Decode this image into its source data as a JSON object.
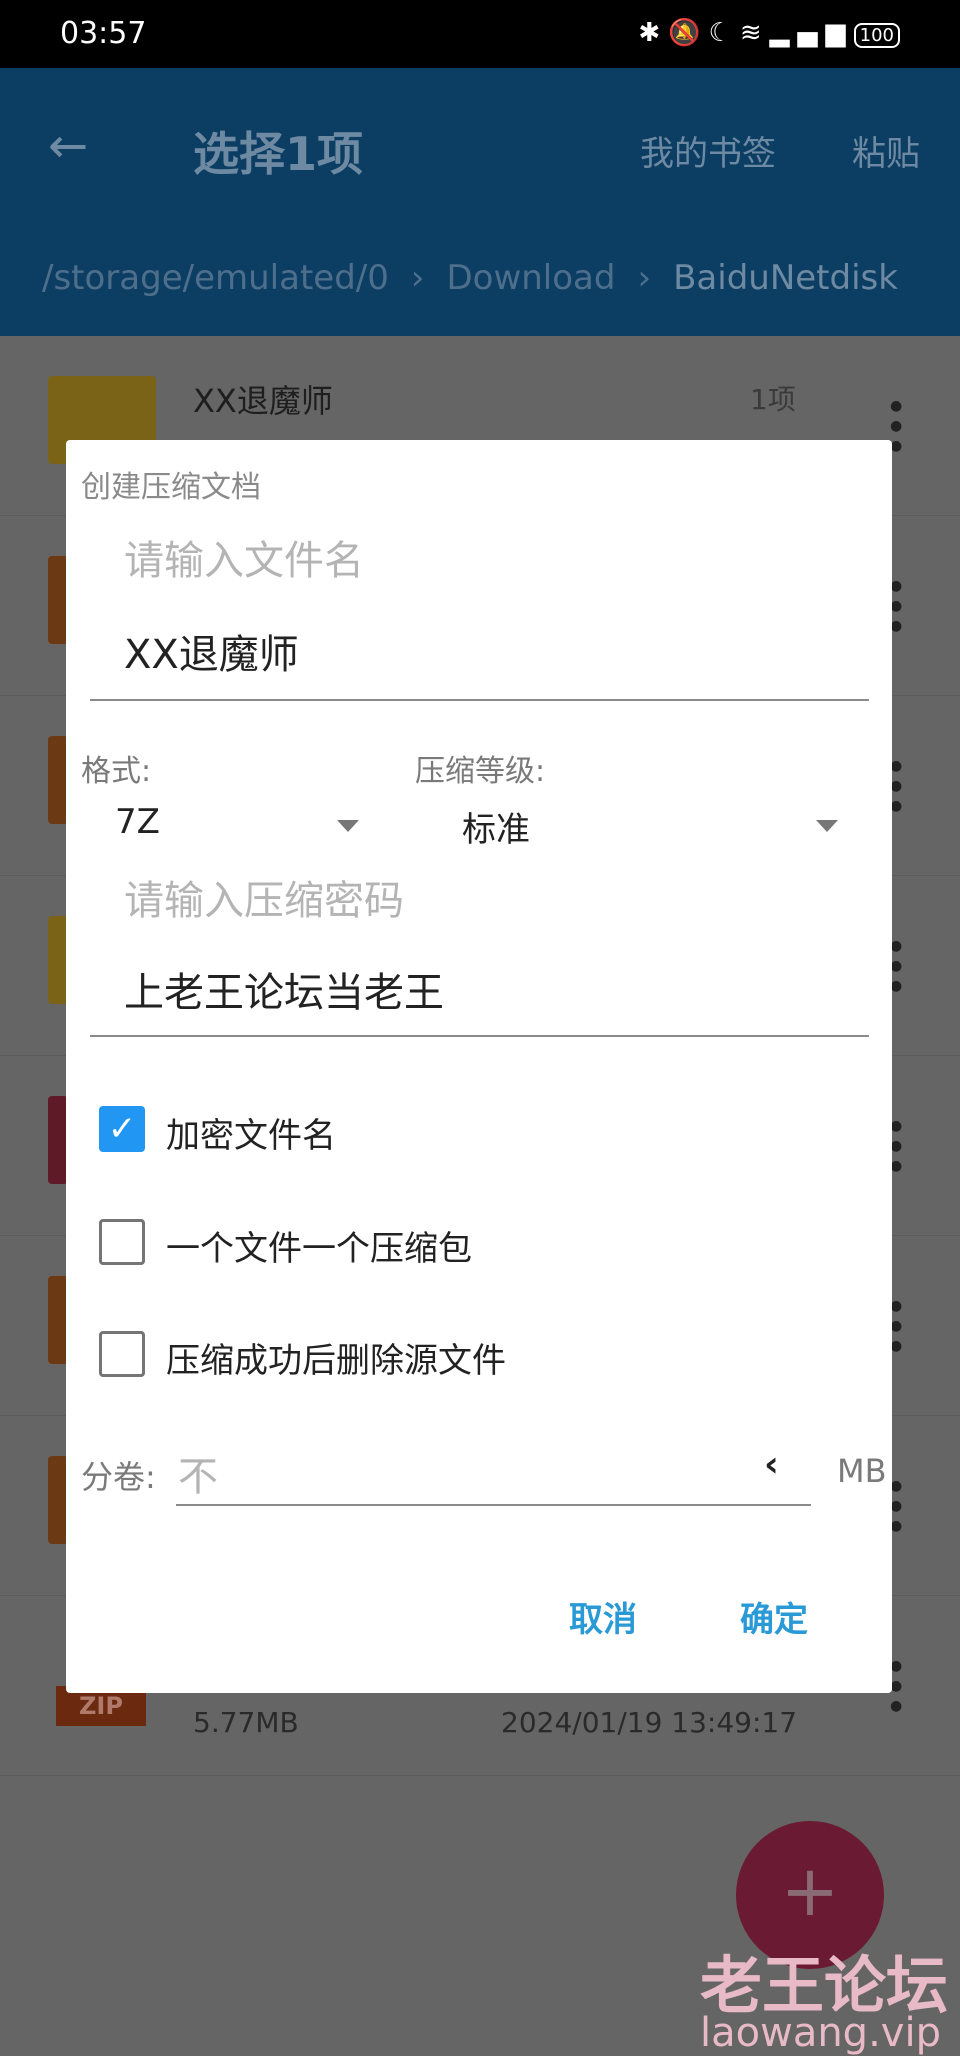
{
  "status_bar": {
    "time": "03:57",
    "icons": [
      "bluetooth-icon",
      "mute-icon",
      "moon-icon",
      "wifi-icon",
      "4g-signal-icon",
      "battery-icon"
    ],
    "battery": "100"
  },
  "app_bar": {
    "title": "选择1项",
    "bookmarks": "我的书签",
    "paste": "粘贴",
    "breadcrumb": [
      "/storage/emulated/0",
      "Download",
      "BaiduNetdisk"
    ]
  },
  "list": {
    "first_item": {
      "name": "XX退魔师",
      "count": "1项"
    },
    "last_item": {
      "badge": "ZIP",
      "size": "5.77MB",
      "date": "2024/01/19 13:49:17"
    }
  },
  "dialog": {
    "title": "创建压缩文档",
    "filename_placeholder": "请输入文件名",
    "filename_value": "XX退魔师",
    "format_label": "格式:",
    "format_value": "7Z",
    "level_label": "压缩等级:",
    "level_value": "标准",
    "password_placeholder": "请输入压缩密码",
    "password_value": "上老王论坛当老王",
    "checkboxes": [
      {
        "label": "加密文件名",
        "checked": true
      },
      {
        "label": "一个文件一个压缩包",
        "checked": false
      },
      {
        "label": "压缩成功后删除源文件",
        "checked": false
      }
    ],
    "split_label": "分卷:",
    "split_value": "不",
    "split_unit": "MB",
    "cancel": "取消",
    "ok": "确定"
  },
  "fab": "+",
  "watermark": {
    "cn": "老王论坛",
    "url": "laowang.vip"
  },
  "colors": {
    "appbar": "#0c3d63",
    "accent": "#2196f3",
    "button": "#2a9ad6",
    "fab": "#6b1a33"
  }
}
